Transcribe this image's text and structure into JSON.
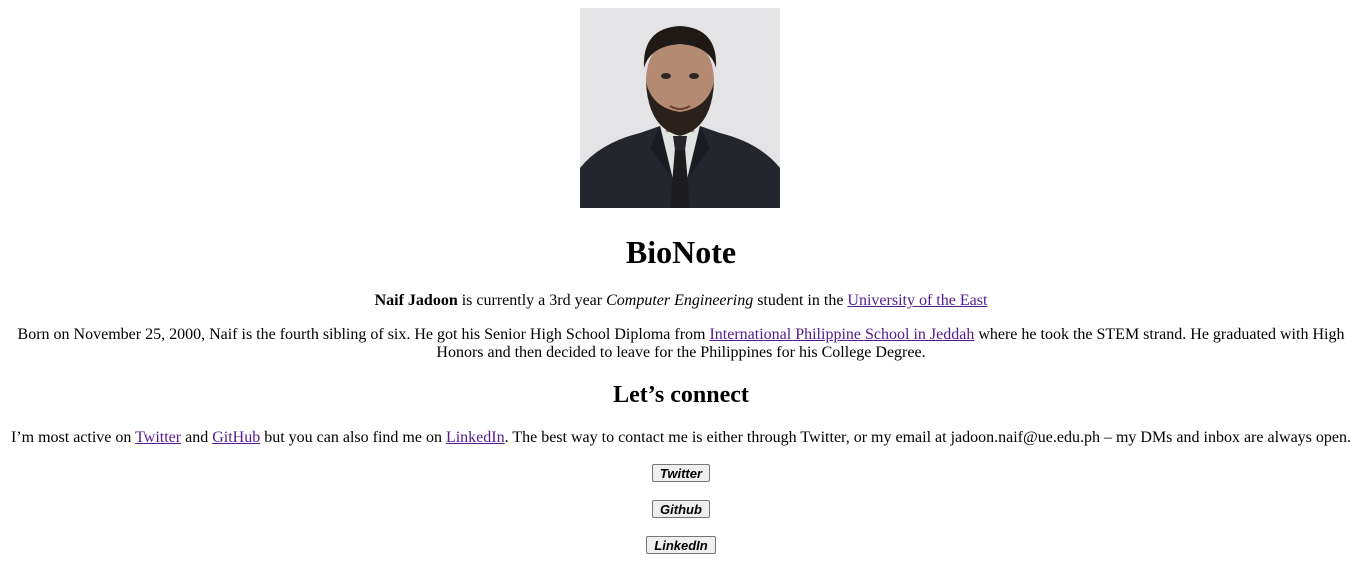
{
  "profile": {
    "photo_alt": "Naif Jadoon portrait"
  },
  "heading": "BioNote",
  "intro": {
    "name": "Naif Jadoon",
    "text1": " is currently a 3rd year ",
    "course": "Computer Engineering",
    "text2": " student in the ",
    "university_link": "University of the East"
  },
  "born": {
    "text1": "Born on November 25, 2000, Naif is the fourth sibling of six. He got his Senior High School Diploma from ",
    "school_link": "International Philippine School in Jeddah",
    "text2": " where he took the STEM strand. He graduated with High Honors and then decided to leave for the Philippines for his College Degree."
  },
  "connect_heading": "Let’s connect",
  "connect": {
    "text1": "I’m most active on ",
    "twitter_link": "Twitter",
    "text2": " and ",
    "github_link": "GitHub",
    "text3": " but you can also find me on ",
    "linkedin_link": "LinkedIn",
    "text4": ". The best way to contact me is either through Twitter, or my email at jadoon.naif@ue.edu.ph – my DMs and inbox are always open."
  },
  "buttons": {
    "twitter": "Twitter",
    "github": "Github",
    "linkedin": "LinkedIn"
  },
  "colors": {
    "link": "#551a8b",
    "button_bg": "#efefef"
  }
}
